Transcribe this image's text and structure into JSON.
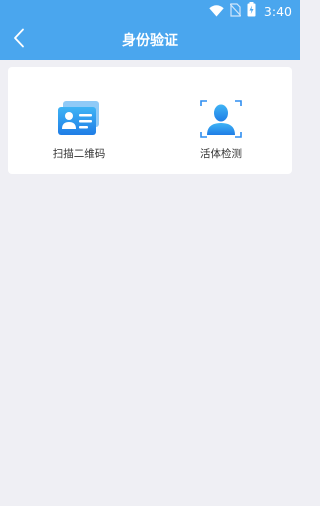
{
  "status": {
    "time": "3:40",
    "icons": [
      "wifi-icon",
      "no-sim-icon",
      "battery-charging-icon"
    ]
  },
  "header": {
    "title": "身份验证",
    "back_icon": "chevron-left-icon"
  },
  "options": [
    {
      "label": "扫描二维码",
      "icon": "id-card-icon"
    },
    {
      "label": "活体检测",
      "icon": "face-scan-icon"
    }
  ],
  "colors": {
    "header": "#4aa6ee",
    "background": "#efeff4",
    "card": "#ffffff",
    "icon_blue": "#2f8ef0",
    "text": "#333333"
  }
}
